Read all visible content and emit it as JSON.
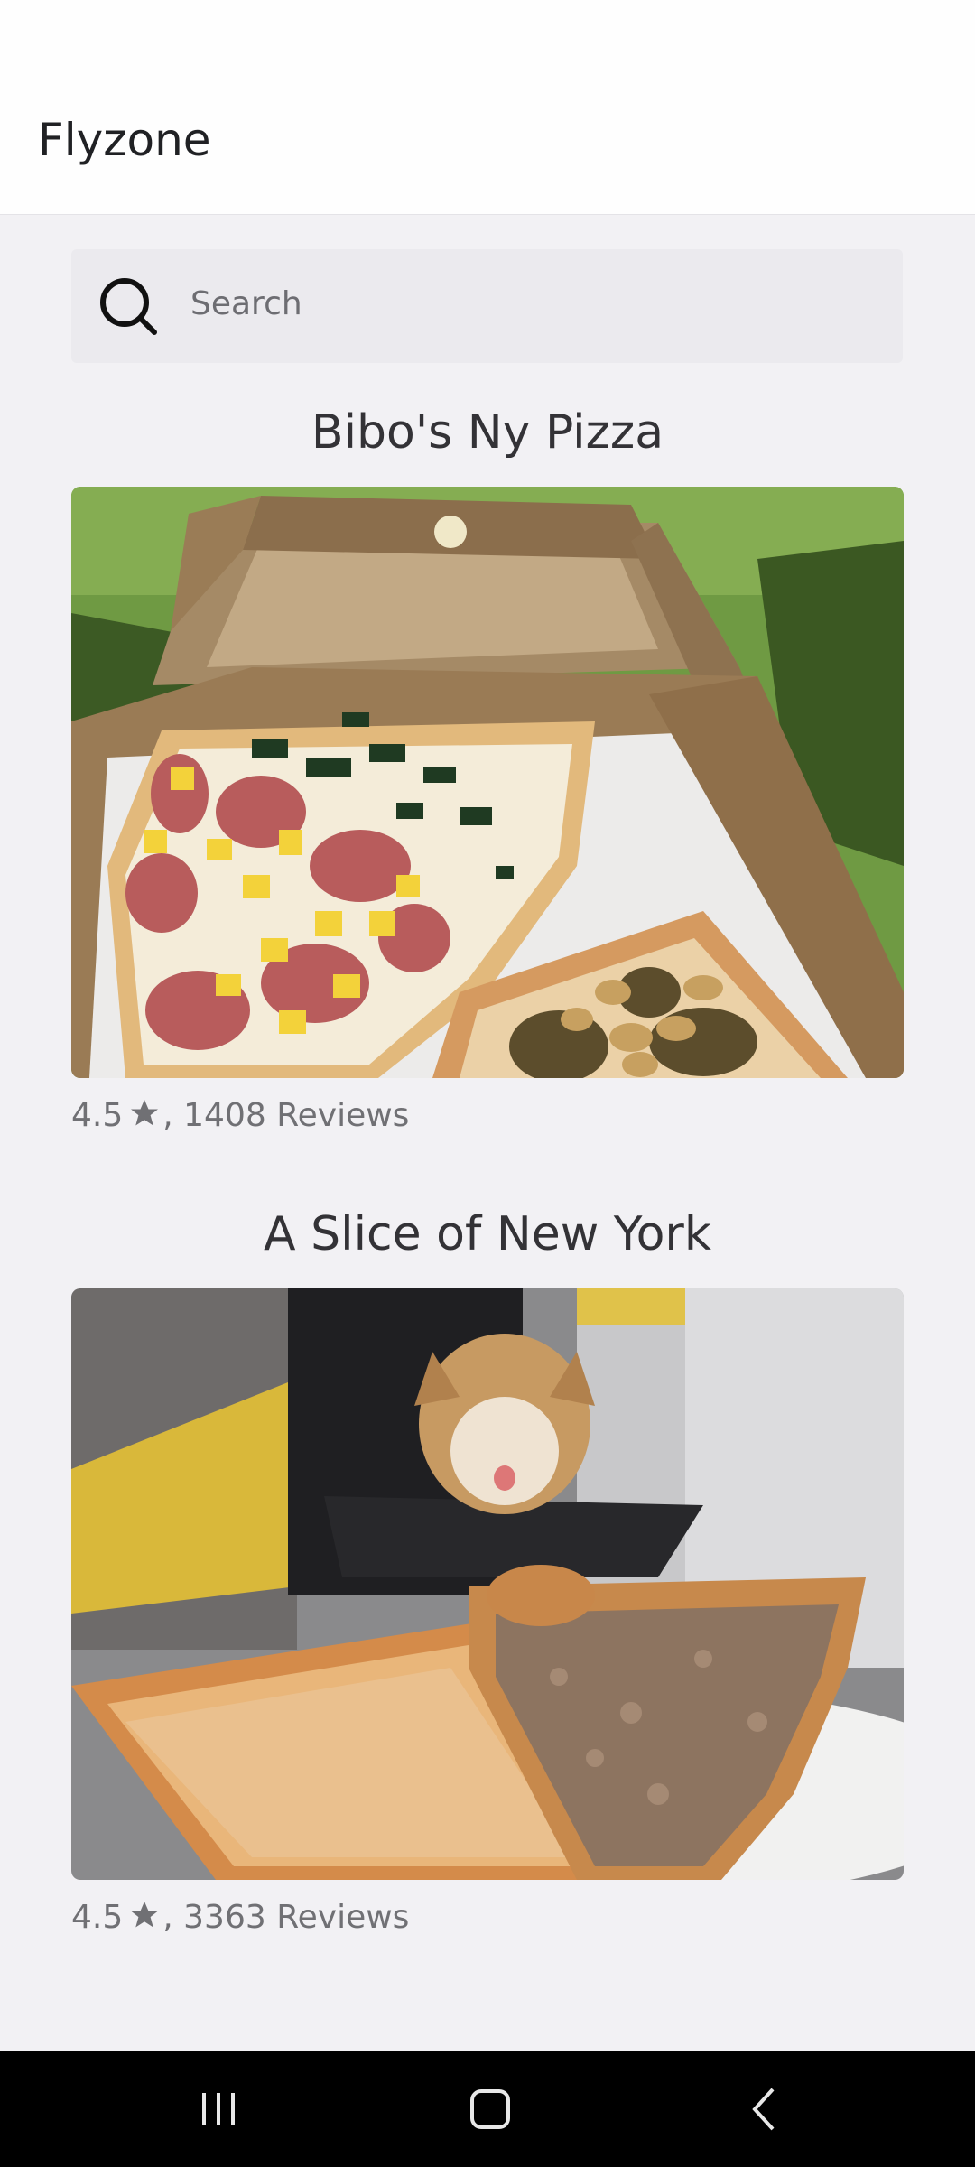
{
  "app": {
    "title": "Flyzone"
  },
  "search": {
    "placeholder": "Search",
    "icon": "search-icon"
  },
  "restaurants": [
    {
      "name": "Bibo's Ny Pizza",
      "rating": "4.5",
      "reviews_suffix": ", 1408 Reviews",
      "image": "pizza-box-photo"
    },
    {
      "name": "A Slice of New York",
      "rating": "4.5",
      "reviews_suffix": ", 3363 Reviews",
      "image": "pizza-slices-dog-photo"
    }
  ],
  "navbar": {
    "recents_icon": "recents-icon",
    "home_icon": "home-icon",
    "back_icon": "back-icon"
  },
  "colors": {
    "background": "#f2f1f4",
    "header": "#fefefe",
    "navbar": "#000000",
    "text": "#202124",
    "muted": "#707074"
  }
}
